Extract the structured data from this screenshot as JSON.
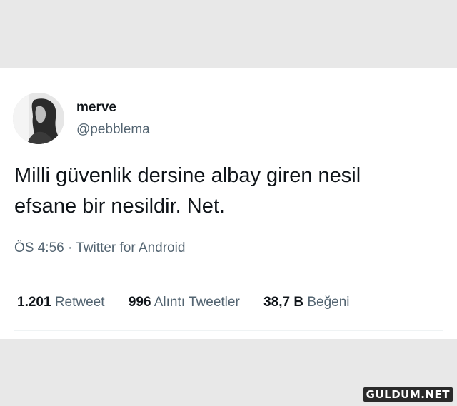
{
  "tweet": {
    "display_name": "merve",
    "handle": "@pebblema",
    "text_line1": "Milli güvenlik dersine albay giren nesil",
    "text_line2": "efsane bir nesildir. Net.",
    "time": "ÖS 4:56",
    "separator": "·",
    "source": "Twitter for Android",
    "stats": [
      {
        "value": "1.201",
        "label": "Retweet"
      },
      {
        "value": "996",
        "label": "Alıntı Tweetler"
      },
      {
        "value": "38,7 B",
        "label": "Beğeni"
      }
    ]
  },
  "watermark": "GULDUM.NET"
}
